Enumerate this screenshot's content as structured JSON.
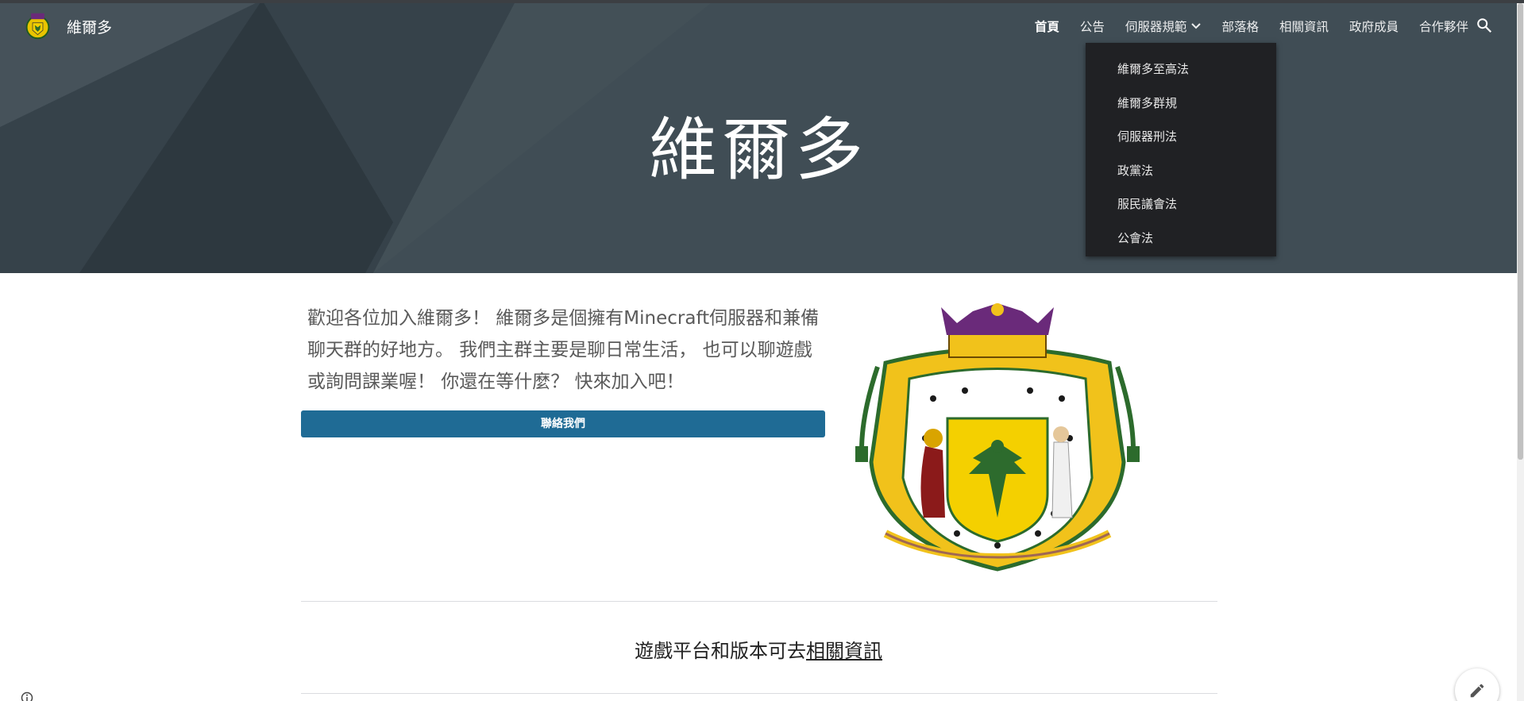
{
  "site": {
    "name": "維爾多",
    "logo_icon": "coat-of-arms-icon"
  },
  "nav": {
    "items": [
      {
        "label": "首頁",
        "active": true
      },
      {
        "label": "公告"
      },
      {
        "label": "伺服器規範",
        "has_dropdown": true
      },
      {
        "label": "部落格"
      },
      {
        "label": "相關資訊"
      },
      {
        "label": "政府成員"
      },
      {
        "label": "合作夥伴"
      }
    ],
    "search_icon": "search-icon"
  },
  "dropdown": {
    "items": [
      "維爾多至高法",
      "維爾多群規",
      "伺服器刑法",
      "政黨法",
      "服民議會法",
      "公會法"
    ]
  },
  "hero": {
    "title": "維爾多"
  },
  "intro": {
    "text": "歡迎各位加入維爾多！ 維爾多是個擁有Minecraft伺服器和兼備聊天群的好地方。 我們主群主要是聊日常生活， 也可以聊遊戲或詢問課業喔！ 你還在等什麼？ 快來加入吧！",
    "button_label": "聯絡我們"
  },
  "info": {
    "prefix": "遊戲平台和版本可去",
    "link": "相關資訊"
  },
  "colors": {
    "hero_bg": "#3d4950",
    "button": "#1f6b95",
    "dropdown_bg": "#202124"
  }
}
